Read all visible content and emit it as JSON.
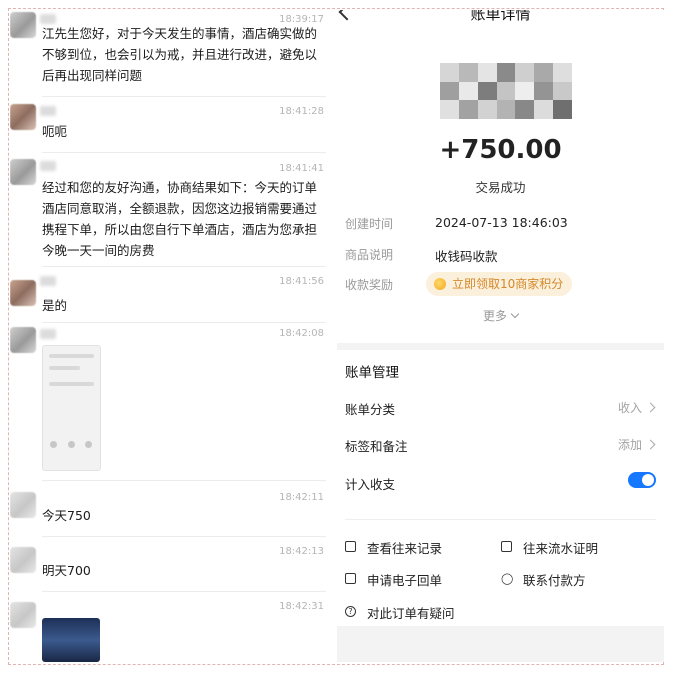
{
  "chat": {
    "messages": [
      {
        "time": "18:39:17",
        "text": "江先生您好，对于今天发生的事情，酒店确实做的不够到位，也会引以为戒，并且进行改进，避免以后再出现同样问题"
      },
      {
        "time": "18:41:28",
        "text": "呃呃"
      },
      {
        "time": "18:41:41",
        "text": "经过和您的友好沟通，协商结果如下：今天的订单酒店同意取消，全额退款，因您这边报销需要通过携程下单，所以由您自行下单酒店，酒店为您承担今晚一天一间的房费"
      },
      {
        "time": "18:41:56",
        "text": "是的"
      },
      {
        "time": "18:42:08",
        "text": ""
      },
      {
        "time": "18:42:11",
        "text": "今天750"
      },
      {
        "time": "18:42:13",
        "text": "明天700"
      },
      {
        "time": "18:42:31",
        "text": ""
      }
    ]
  },
  "bill": {
    "title": "账单详情",
    "amount": "+750.00",
    "status": "交易成功",
    "created_label": "创建时间",
    "created_value": "2024-07-13 18:46:03",
    "desc_label": "商品说明",
    "desc_value": "收钱码收款",
    "reward_label": "收款奖励",
    "reward_button": "立即领取10商家积分",
    "more": "更多",
    "accent_color": "#1677ff",
    "reward_color": "#d4892a"
  },
  "management": {
    "title": "账单管理",
    "category_label": "账单分类",
    "category_value": "收入",
    "tags_label": "标签和备注",
    "tags_value": "添加",
    "include_label": "计入收支",
    "include_on": true,
    "actions": [
      {
        "label": "查看往来记录",
        "icon": "records-icon"
      },
      {
        "label": "往来流水证明",
        "icon": "proof-icon"
      },
      {
        "label": "申请电子回单",
        "icon": "mail-icon"
      },
      {
        "label": "联系付款方",
        "icon": "contact-icon"
      },
      {
        "label": "对此订单有疑问",
        "icon": "help-icon"
      }
    ]
  }
}
